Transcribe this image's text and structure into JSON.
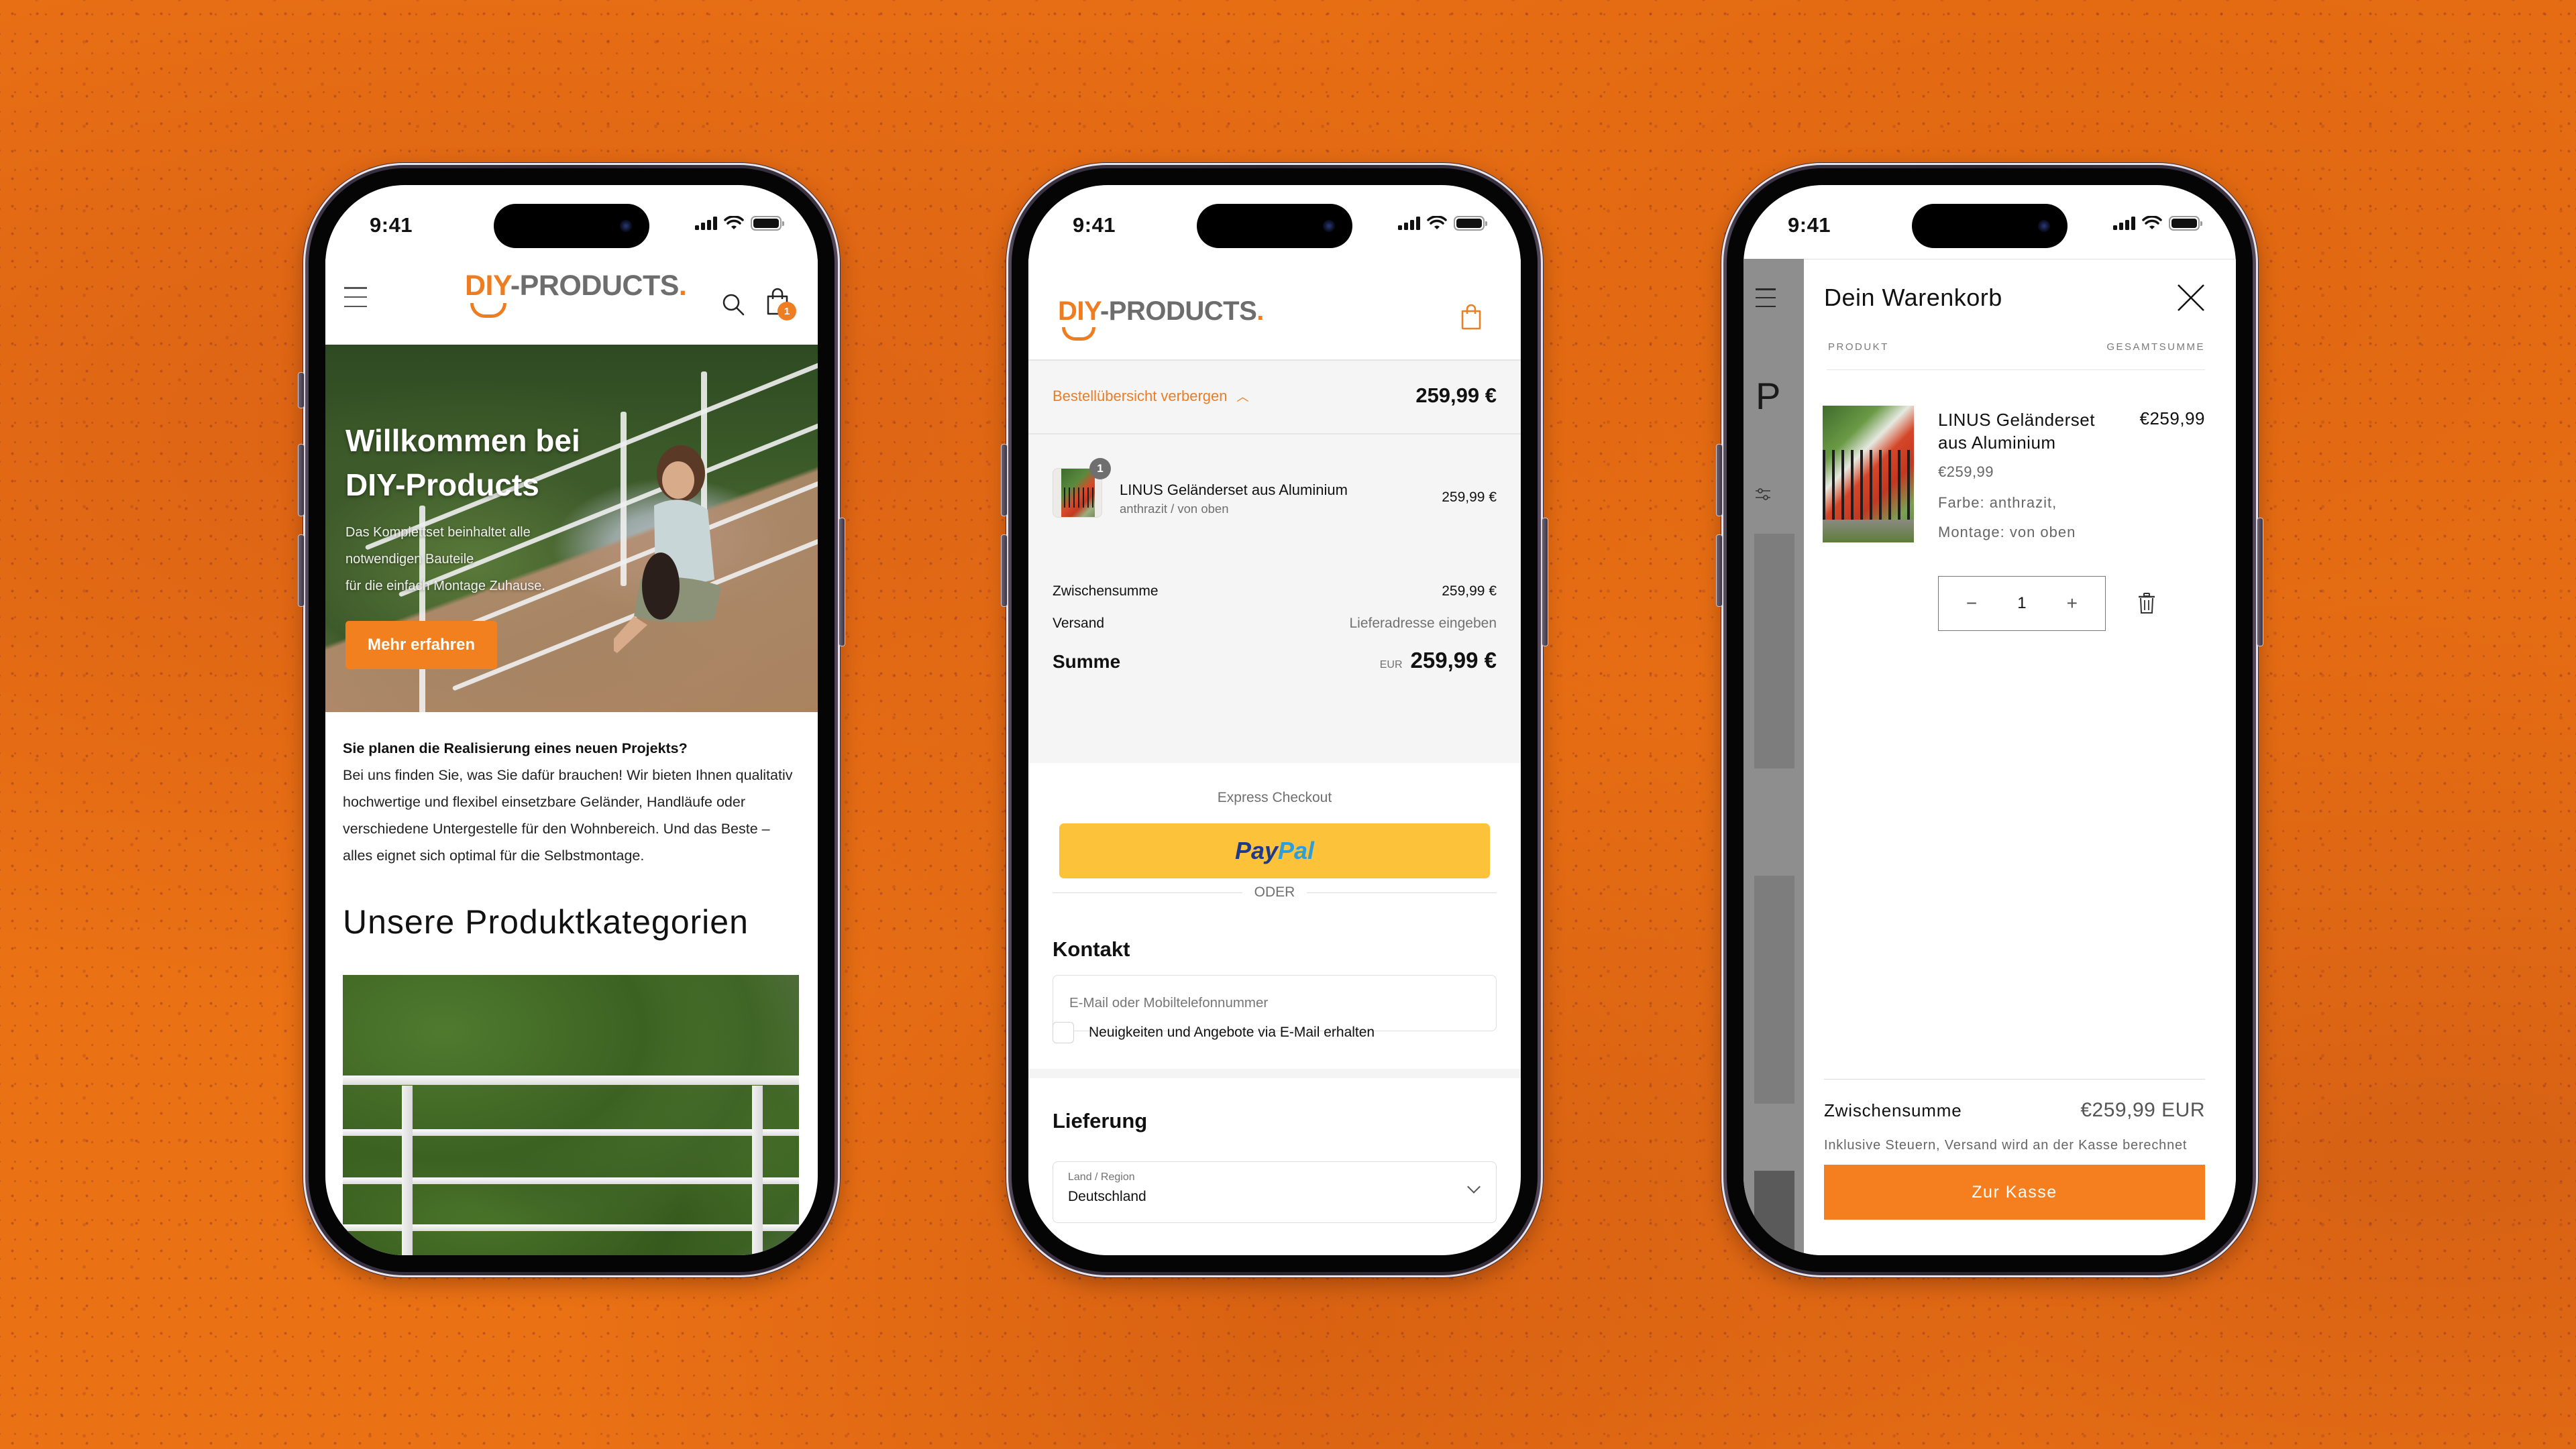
{
  "scene": {
    "background_color": "#ea7114",
    "accent_color": "#ef7d22"
  },
  "status_bar": {
    "time": "9:41"
  },
  "brand": {
    "logo_diy": "DIY",
    "logo_rest": "-PRODUCTS",
    "logo_dot": "."
  },
  "home": {
    "cart_count": "1",
    "hero": {
      "title_line1": "Willkommen bei",
      "title_line2": "DIY-Products",
      "sub_line1": "Das Komplettset beinhaltet alle",
      "sub_line2": "notwendigen Bauteile",
      "sub_line3": "für die einfach Montage Zuhause.",
      "button_label": "Mehr erfahren"
    },
    "intro": {
      "heading": "Sie planen die Realisierung eines neuen Projekts?",
      "body": "Bei uns finden Sie, was Sie dafür brauchen! Wir bieten Ihnen qualitativ hochwertige und flexibel einsetzbare Geländer, Handläufe oder verschiedene Untergestelle für den Wohnbereich. Und das Beste – alles eignet sich optimal für die Selbstmontage."
    },
    "categories_title": "Unsere Produktkategorien"
  },
  "checkout": {
    "summary_toggle_label": "Bestellübersicht verbergen",
    "summary_total": "259,99 €",
    "line_item": {
      "quantity": "1",
      "name": "LINUS Geländerset aus Aluminium",
      "variant": "anthrazit / von oben",
      "price": "259,99 €"
    },
    "totals": {
      "subtotal_label": "Zwischensumme",
      "subtotal_value": "259,99 €",
      "shipping_label": "Versand",
      "shipping_value": "Lieferadresse eingeben",
      "total_label": "Summe",
      "total_currency": "EUR",
      "total_value": "259,99 €"
    },
    "express_label": "Express Checkout",
    "paypal_pay": "Pay",
    "paypal_pal": "Pal",
    "divider_label": "ODER",
    "contact": {
      "title": "Kontakt",
      "email_placeholder": "E-Mail oder Mobiltelefonnummer",
      "email_value": "",
      "newsletter_label": "Neuigkeiten und Angebote via E-Mail erhalten",
      "newsletter_checked": false
    },
    "delivery": {
      "title": "Lieferung",
      "country_label": "Land / Region",
      "country_value": "Deutschland"
    }
  },
  "cart_drawer": {
    "title": "Dein Warenkorb",
    "col_product": "PRODUKT",
    "col_total": "GESAMTSUMME",
    "item": {
      "name_line1": "LINUS Geländerset",
      "name_line2": "aus Aluminium",
      "line_total": "€259,99",
      "unit_price": "€259,99",
      "option_color": "Farbe: anthrazit,",
      "option_mount": "Montage: von oben",
      "quantity": "1",
      "minus": "−",
      "plus": "+"
    },
    "subtotal_label": "Zwischensumme",
    "subtotal_value": "€259,99 EUR",
    "tax_note": "Inklusive Steuern, Versand wird an der Kasse berechnet",
    "checkout_label": "Zur Kasse",
    "background_page_letter": "P"
  }
}
